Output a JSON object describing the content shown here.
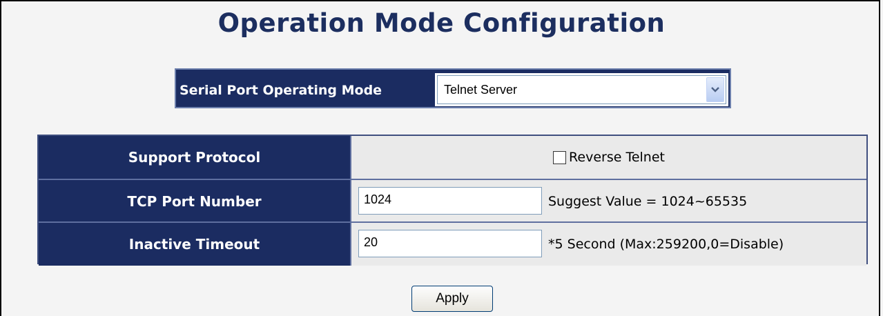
{
  "page": {
    "title": "Operation Mode Configuration"
  },
  "mode": {
    "label": "Serial Port Operating Mode",
    "selected": "Telnet Server"
  },
  "config": {
    "support_protocol": {
      "label": "Support Protocol",
      "option_label": "Reverse Telnet",
      "checked": false
    },
    "tcp_port": {
      "label": "TCP Port Number",
      "value": "1024",
      "hint": "Suggest Value = 1024~65535"
    },
    "inactive_timeout": {
      "label": "Inactive Timeout",
      "value": "20",
      "hint": "*5 Second (Max:259200,0=Disable)"
    }
  },
  "actions": {
    "apply_label": "Apply"
  },
  "colors": {
    "title": "#1c2e5f",
    "header_bg": "#1b2c61",
    "cell_bg": "#eaeaea"
  }
}
